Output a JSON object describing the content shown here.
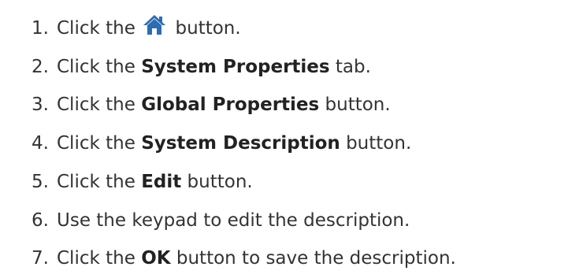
{
  "steps": [
    {
      "num": "1.",
      "before": "Click the ",
      "bold": "",
      "after": " button.",
      "icon": "home-icon"
    },
    {
      "num": "2.",
      "before": "Click the ",
      "bold": "System Properties",
      "after": " tab."
    },
    {
      "num": "3.",
      "before": "Click the ",
      "bold": "Global Properties",
      "after": " button."
    },
    {
      "num": "4.",
      "before": "Click the ",
      "bold": "System Description",
      "after": " button."
    },
    {
      "num": "5.",
      "before": "Click the ",
      "bold": "Edit",
      "after": " button."
    },
    {
      "num": "6.",
      "before": "Use the keypad to edit the description.",
      "bold": "",
      "after": ""
    },
    {
      "num": "7.",
      "before": "Click the ",
      "bold": "OK",
      "after": " button to save the description."
    }
  ],
  "colors": {
    "text": "#333333",
    "icon": "#2b6db4"
  }
}
